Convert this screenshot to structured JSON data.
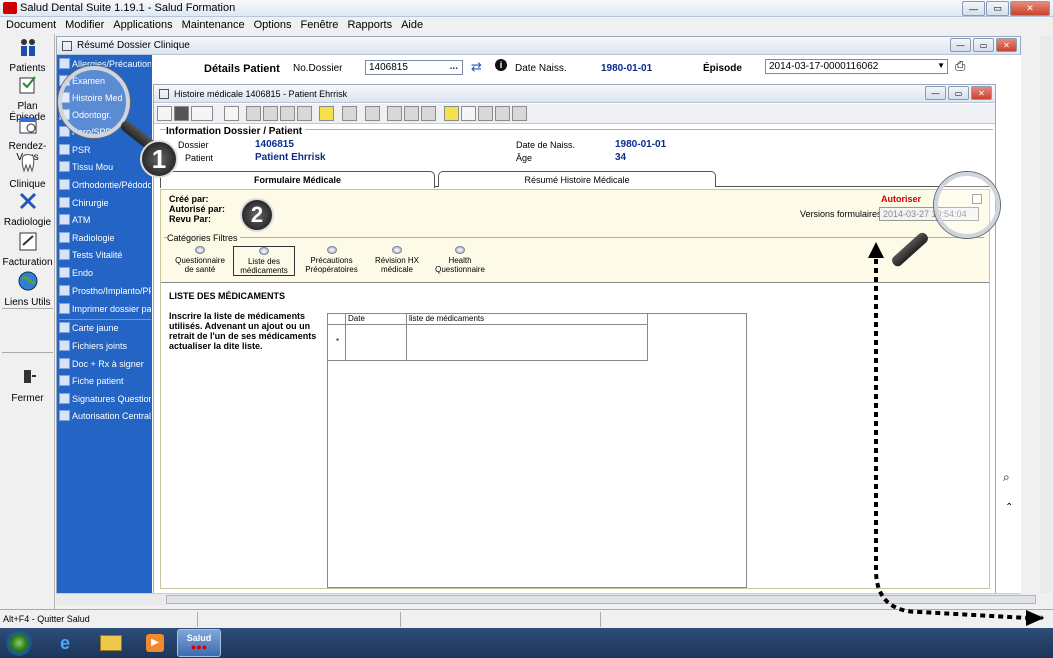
{
  "app": {
    "title": "Salud Dental Suite 1.19.1 - Salud Formation",
    "window_controls": {
      "minimize": "—",
      "restore": "▭",
      "close": "✕"
    }
  },
  "menu": [
    "Document",
    "Modifier",
    "Applications",
    "Maintenance",
    "Options",
    "Fenêtre",
    "Rapports",
    "Aide"
  ],
  "left_toolbar": {
    "items": [
      "Patients",
      "Plan Épisode",
      "Rendez-Vous",
      "Clinique",
      "Radiologie",
      "Facturation",
      "Liens Utils",
      "Fermer"
    ]
  },
  "blue_sidebar": {
    "items": [
      "Allergies/Précautions préop.",
      "Examen",
      "Histoire Med",
      "Odontogr.",
      "Paro/SPP",
      "PSR",
      "Tissu Mou",
      "Orthodontie/Pédodon",
      "Chirurgie",
      "ATM",
      "Radiologie",
      "Tests Vitalité",
      "Endo",
      "Prostho/Implanto/PPF",
      "Imprimer dossier patie"
    ],
    "items2": [
      "Carte jaune",
      "Fichiers joints",
      "Doc + Rx à signer",
      "Fiche patient",
      "Signatures Questionna",
      "Autorisation Centrale"
    ]
  },
  "outer_window": {
    "title": "Résumé Dossier Clinique",
    "details_label": "Détails Patient",
    "no_dossier_label": "No.Dossier",
    "no_dossier_value": "1406815",
    "ellipsis": "...",
    "date_naiss_label": "Date Naiss.",
    "date_naiss_value": "1980-01-01",
    "episode_label": "Épisode",
    "episode_value": "2014-03-17-0000116062"
  },
  "inner_window": {
    "title": "Histoire médicale 1406815 - Patient Ehrrisk",
    "info_header": "Information Dossier / Patient",
    "dossier_label": "Dossier",
    "dossier_value": "1406815",
    "patient_label": "Patient",
    "patient_value": "Patient Ehrrisk",
    "dob_label": "Date de Naiss.",
    "dob_value": "1980-01-01",
    "age_label": "Âge",
    "age_value": "34",
    "tab_active": "Formulaire Médicale",
    "tab_other": "Résumé Histoire Médicale",
    "cree_par": "Créé par:",
    "autorise_par": "Autorisé par:",
    "revu_par": "Revu Par:",
    "autoriser": "Autoriser",
    "versions_label": "Versions formulaires:",
    "versions_value": "2014-03-27 10:54:04",
    "categories_label": "Catégories Filtres",
    "categories": [
      "Questionnaire\nde santé",
      "Liste des\nmédicaments",
      "Précautions\nPréopératoires",
      "Révision HX\nmédicale",
      "Health\nQuestionnaire"
    ],
    "list_title": "LISTE DES MÉDICAMENTS",
    "instructions": "Inscrire la liste de médicaments utilisés.  Advenant un ajout ou un retrait de l'un de ses médicaments actualiser la dite liste.",
    "grid_col_date": "Date",
    "grid_col_list": "liste de médicaments",
    "grid_new_row": "*"
  },
  "statusbar": {
    "text": "Alt+F4 - Quitter Salud"
  },
  "taskbar": {
    "salud_label": "Salud"
  },
  "annotations": {
    "badge1": "1",
    "badge2": "2"
  },
  "colors": {
    "sidebar_blue": "#2464c4",
    "value_blue": "#0c2b8c",
    "autoriser_red": "#d00000",
    "form_yellow": "#fdfbe7"
  }
}
